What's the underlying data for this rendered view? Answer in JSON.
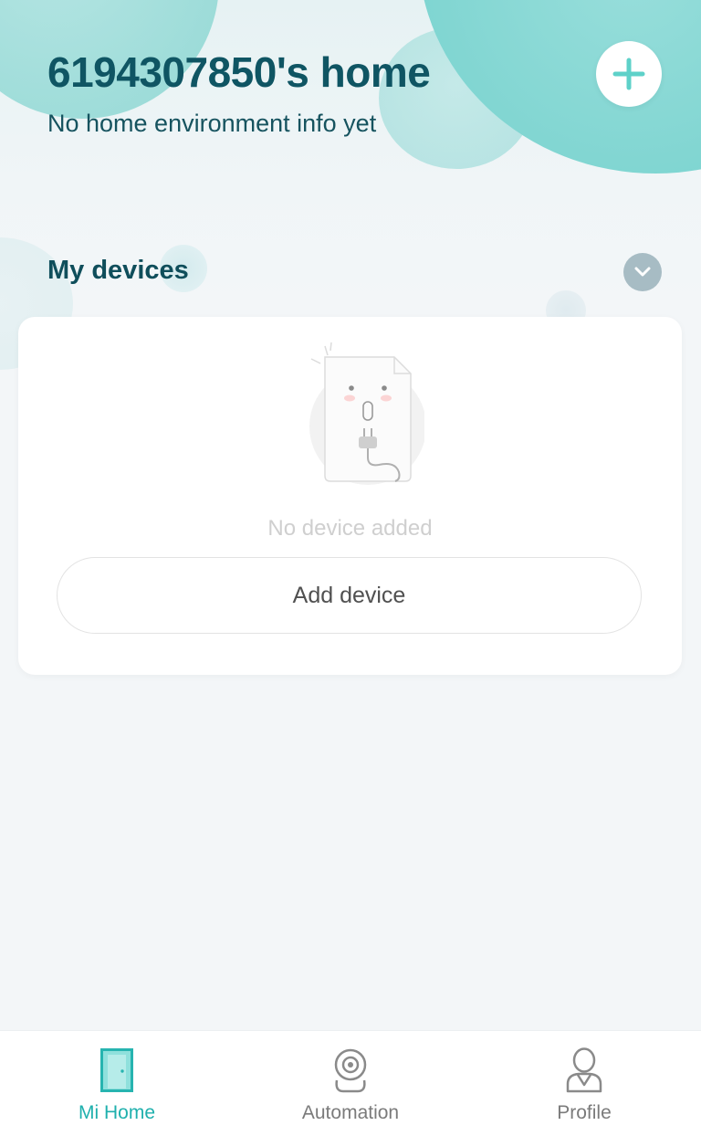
{
  "header": {
    "title": "6194307850's home",
    "subtitle": "No home environment info yet",
    "add_icon": "plus-icon"
  },
  "devices": {
    "section_title": "My devices",
    "collapse_icon": "chevron-down-icon",
    "empty_illustration": "unplugged-device-illustration",
    "empty_text": "No device added",
    "add_button_label": "Add device"
  },
  "bottom_nav": {
    "items": [
      {
        "label": "Mi Home",
        "icon": "door-icon",
        "active": true
      },
      {
        "label": "Automation",
        "icon": "camera-icon",
        "active": false
      },
      {
        "label": "Profile",
        "icon": "person-icon",
        "active": false
      }
    ]
  },
  "colors": {
    "accent": "#1fb0ad",
    "title": "#0f5563",
    "blob": "#7fd5d1",
    "nav_inactive": "#7b7b7b",
    "empty_text": "#cfcfcf"
  }
}
